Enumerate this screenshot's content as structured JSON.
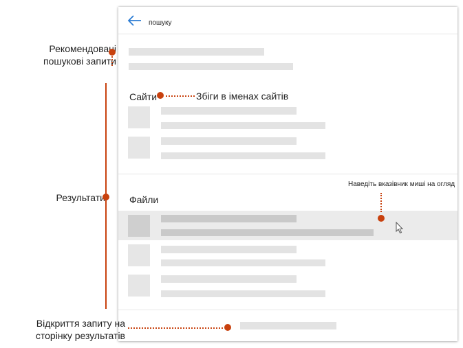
{
  "colors": {
    "accent_annotation": "#c8410e",
    "back_arrow": "#2b7cd3",
    "placeholder_bar": "#e3e3e3",
    "hover_row": "#ebebeb"
  },
  "search": {
    "query_text": "пошуку",
    "back_icon": "arrow-left-icon"
  },
  "sections": {
    "sites_label": "Сайти",
    "files_label": "Файли"
  },
  "annotations": {
    "suggested_queries": [
      "Рекомендовані",
      "пошукові запити"
    ],
    "results": "Результати",
    "site_name_matches": "Збіги в іменах сайтів",
    "hover_preview": "Наведіть вказівник миші на огляд",
    "open_query": [
      "Відкриття запиту на",
      "сторінку результатів"
    ]
  },
  "pointer": {
    "icon": "mouse-cursor-icon"
  }
}
